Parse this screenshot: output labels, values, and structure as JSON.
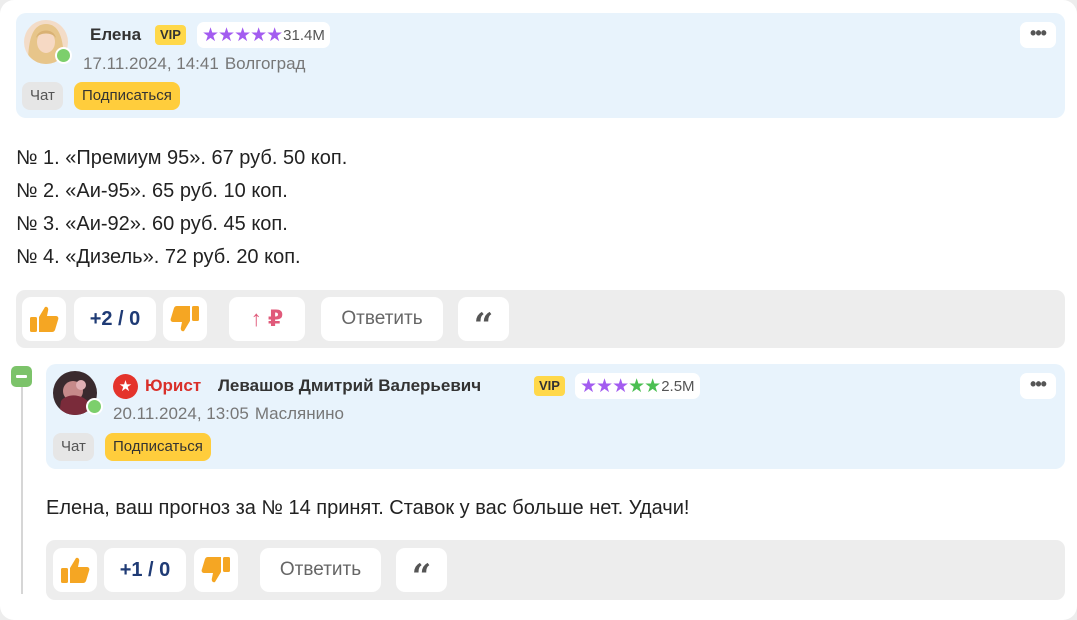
{
  "comment1": {
    "author": "Елена",
    "vip": "VIP",
    "rating": "31.4M",
    "date": "17.11.2024, 14:41",
    "location": "Волгоград",
    "chat_label": "Чат",
    "subscribe_label": "Подписаться",
    "lines": [
      "№ 1. «Премиум 95». 67 руб. 50 коп.",
      "№ 2. «Аи-95». 65 руб. 10 коп.",
      "№ 3. «Аи-92». 60 руб. 45 коп.",
      "№ 4. «Дизель». 72 руб. 20 коп."
    ],
    "score": "+2 / 0",
    "boost": "↑ ₽",
    "reply_label": "Ответить",
    "quote_icon": "“"
  },
  "comment2": {
    "role": "Юрист",
    "author": "Левашов Дмитрий Валерьевич",
    "vip": "VIP",
    "rating": "2.5M",
    "date": "20.11.2024, 13:05",
    "location": "Маслянино",
    "chat_label": "Чат",
    "subscribe_label": "Подписаться",
    "text": "Елена, ваш прогноз за № 14 принят. Ставок у вас больше нет. Удачи!",
    "score": "+1 / 0",
    "reply_label": "Ответить",
    "quote_icon": "“"
  },
  "icons": {
    "more": "•••",
    "role": "★",
    "stars_purple": "★★★★★",
    "stars_mixed_purple": "★★★",
    "stars_mixed_green": "★★"
  },
  "colors": {
    "header_bg": "#e8f3fc",
    "vip": "#ffd84a",
    "subscribe": "#ffcd3c",
    "star_purple": "#a35cf0",
    "star_green": "#4bbf52",
    "like": "#f5a623",
    "score": "#1f3b75",
    "role": "#d9302a",
    "online": "#7ccf6c"
  }
}
